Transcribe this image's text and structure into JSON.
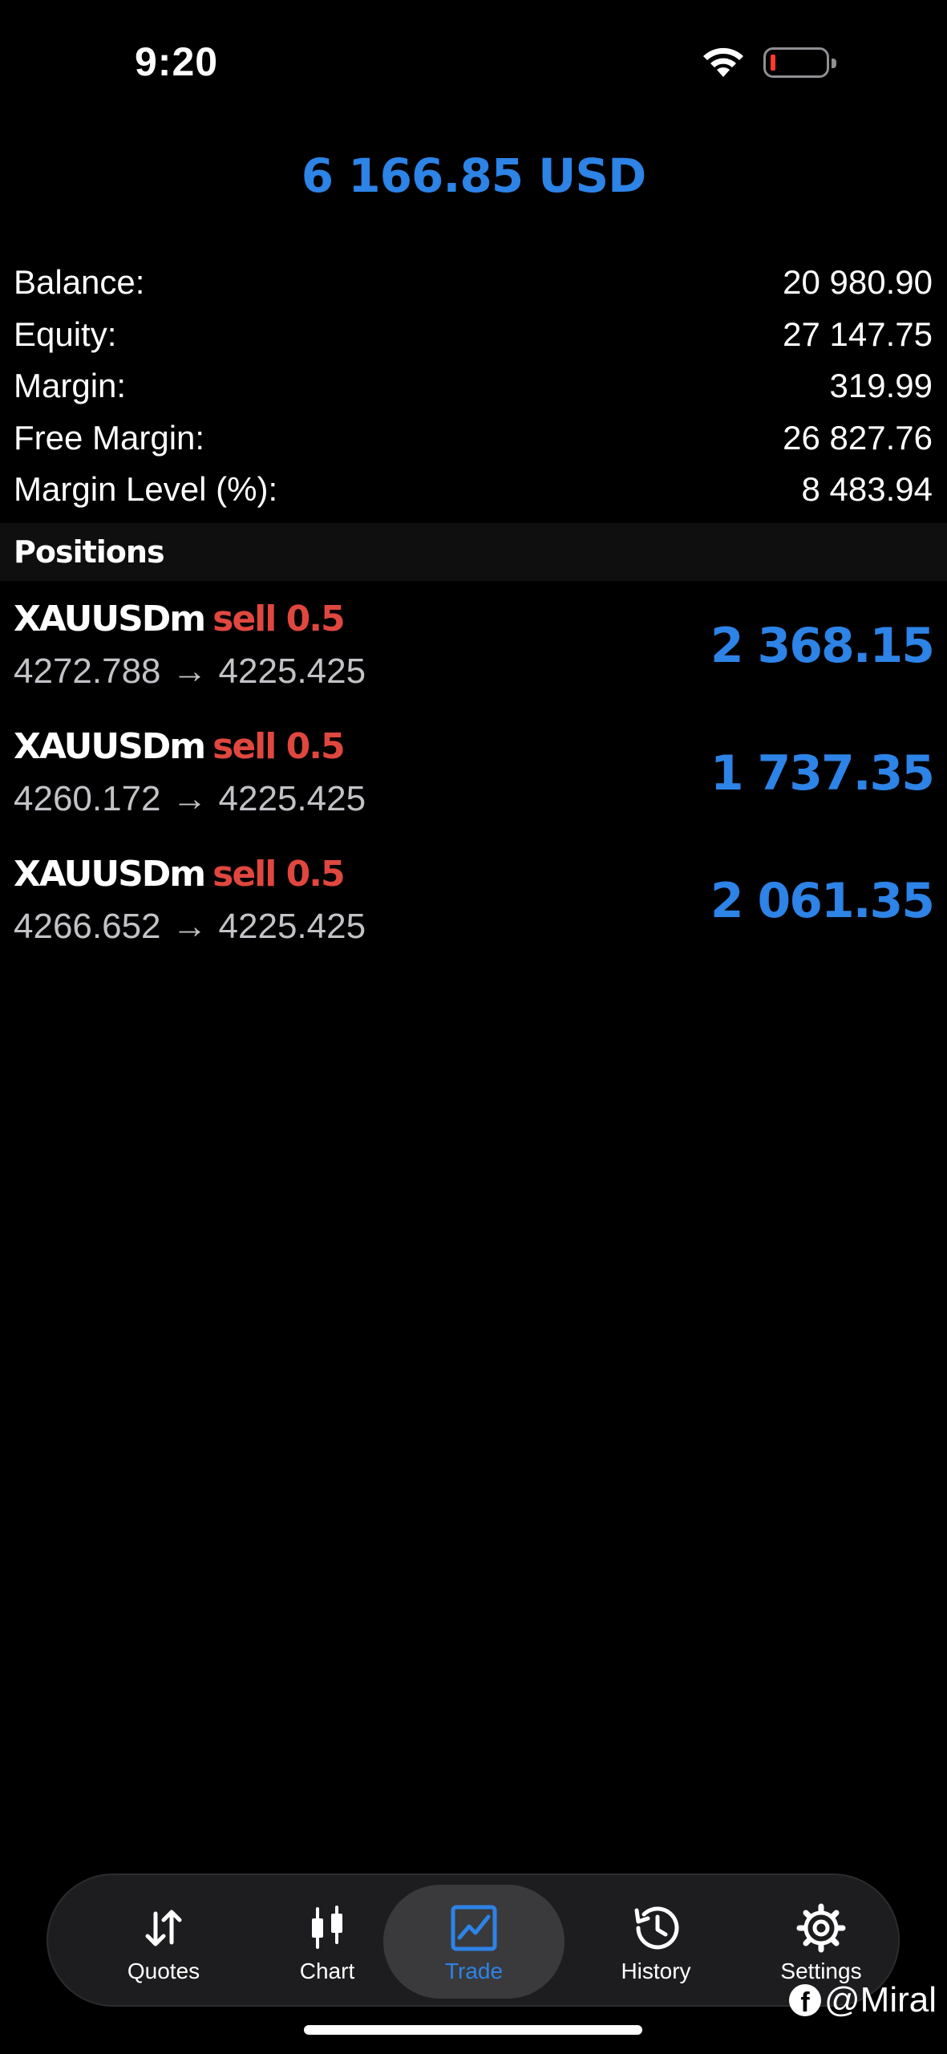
{
  "status_bar": {
    "time": "9:20"
  },
  "account": {
    "total_profit": "6 166.85 USD",
    "summary": [
      {
        "label": "Balance:",
        "value": "20 980.90"
      },
      {
        "label": "Equity:",
        "value": "27 147.75"
      },
      {
        "label": "Margin:",
        "value": "319.99"
      },
      {
        "label": "Free Margin:",
        "value": "26 827.76"
      },
      {
        "label": "Margin Level (%):",
        "value": "8 483.94"
      }
    ]
  },
  "positions_header": "Positions",
  "positions": [
    {
      "symbol": "XAUUSDm",
      "side": "sell 0.5",
      "open_price": "4272.788",
      "arrow": "→",
      "current_price": "4225.425",
      "profit": "2 368.15"
    },
    {
      "symbol": "XAUUSDm",
      "side": "sell 0.5",
      "open_price": "4260.172",
      "arrow": "→",
      "current_price": "4225.425",
      "profit": "1 737.35"
    },
    {
      "symbol": "XAUUSDm",
      "side": "sell 0.5",
      "open_price": "4266.652",
      "arrow": "→",
      "current_price": "4225.425",
      "profit": "2 061.35"
    }
  ],
  "tabbar": {
    "items": [
      {
        "label": "Quotes",
        "icon": "arrows-updown-icon"
      },
      {
        "label": "Chart",
        "icon": "candlestick-icon"
      },
      {
        "label": "Trade",
        "icon": "trade-chart-icon",
        "active": true
      },
      {
        "label": "History",
        "icon": "history-clock-icon"
      },
      {
        "label": "Settings",
        "icon": "gear-icon"
      }
    ]
  },
  "watermark": {
    "text": "@Miral",
    "icon": "facebook-icon"
  },
  "colors": {
    "accent": "#2d83e6",
    "sell": "#e0473f",
    "background": "#000000"
  }
}
